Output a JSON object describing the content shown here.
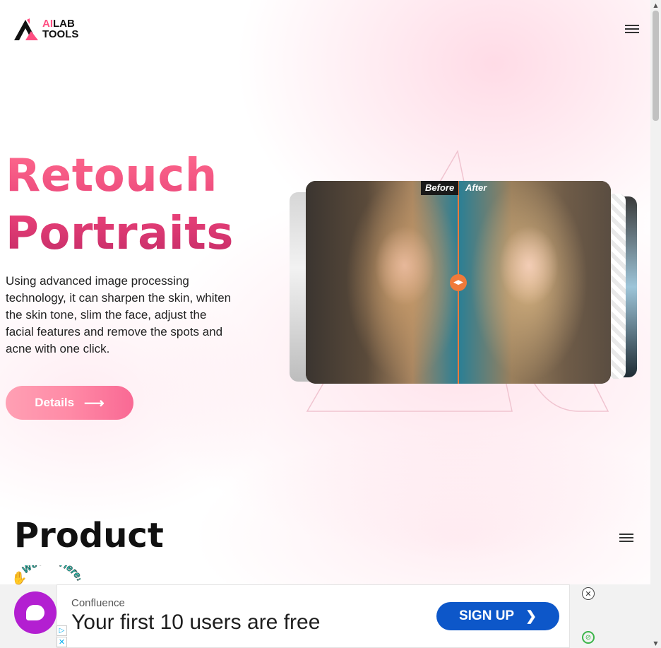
{
  "brand": {
    "logo_line1_accent": "AI",
    "logo_line1_rest": "LAB",
    "logo_line2": "TOOLS",
    "accent_color": "#ff4f82"
  },
  "header": {
    "menu_icon": "hamburger-menu-icon"
  },
  "hero": {
    "title_line1": "Retouch",
    "title_line2": "Portraits",
    "description": "Using advanced image processing technology, it can sharpen the skin, whiten the skin tone, slim the face, adjust the facial features and remove the spots and acne with one click.",
    "details_label": "Details",
    "details_icon": "arrow-right-icon"
  },
  "showcase": {
    "before_label": "Before",
    "after_label": "After",
    "handle_icon": "compare-slider-handle-icon",
    "divider_color": "#f07a3a"
  },
  "product": {
    "title": "Product",
    "menu_icon": "hamburger-menu-icon"
  },
  "chat": {
    "badge_text": "We Are Here!",
    "badge_icon": "waving-hand-icon",
    "button_icon": "chat-bubble-icon",
    "color": "#b31fd1"
  },
  "ad": {
    "brand": "Confluence",
    "headline": "Your first 10 users are free",
    "cta_label": "SIGN UP",
    "cta_icon": "chevron-right-icon",
    "cta_color": "#0d57c9",
    "close_icon": "close-circle-icon",
    "adchoices_icon": "adchoices-icon",
    "dismiss_icon": "close-icon",
    "network_icon": "ad-network-logo-icon"
  }
}
